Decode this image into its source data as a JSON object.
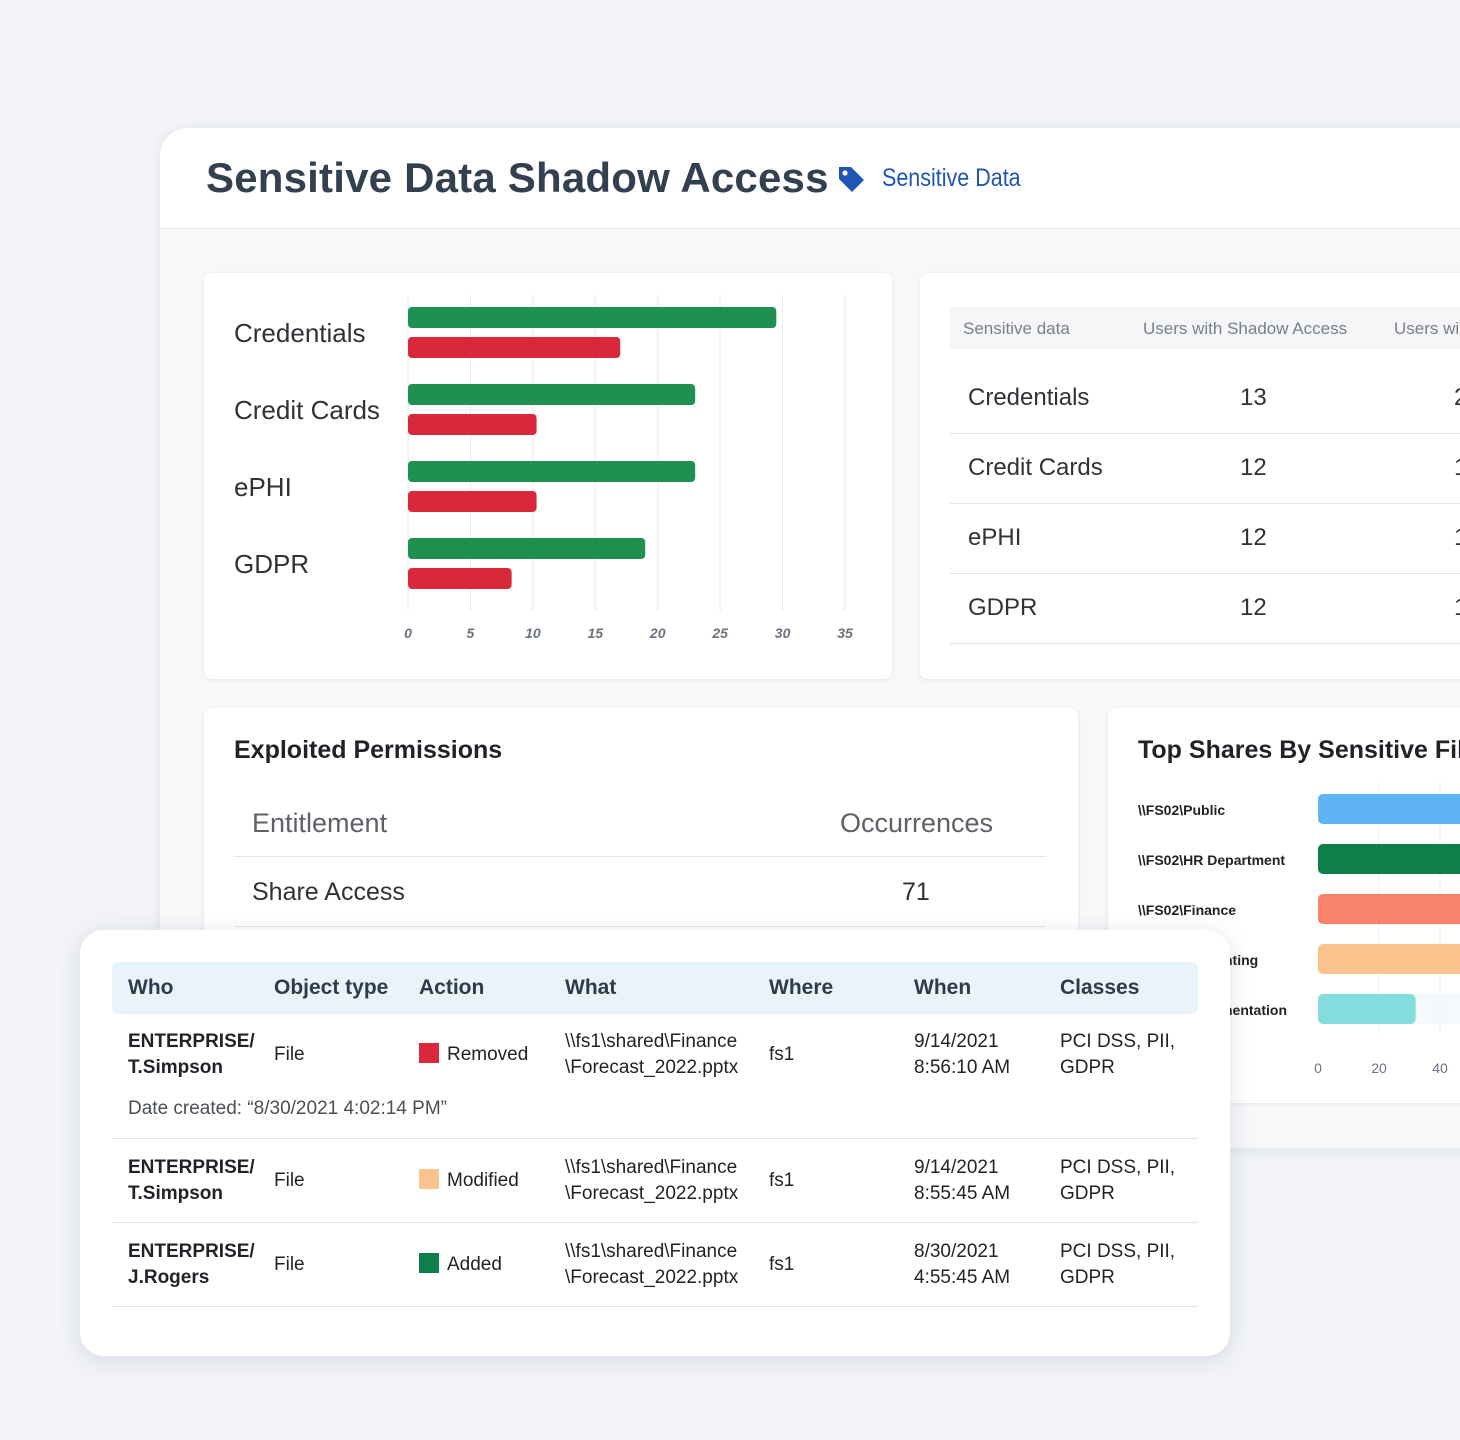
{
  "header": {
    "title": "Sensitive Data Shadow Access",
    "tag_label": "Sensitive Data",
    "tag_color": "#1f56b3"
  },
  "bar_chart": {
    "categories": [
      "Credentials",
      "Credit Cards",
      "ePHI",
      "GDPR"
    ]
  },
  "chart_data": [
    {
      "type": "bar",
      "orientation": "horizontal",
      "categories": [
        "Credentials",
        "Credit Cards",
        "ePHI",
        "GDPR"
      ],
      "series": [
        {
          "color": "#1e9150",
          "values": [
            29.5,
            23,
            23,
            19
          ]
        },
        {
          "color": "#d8283a",
          "values": [
            17,
            10.3,
            10.3,
            8.3
          ]
        }
      ],
      "xlim": [
        0,
        35
      ],
      "xticks": [
        "0",
        "5",
        "10",
        "15",
        "20",
        "25",
        "30",
        "35"
      ],
      "grid": true,
      "title": "",
      "xlabel": "",
      "ylabel": ""
    },
    {
      "type": "bar",
      "orientation": "horizontal",
      "title": "Top Shares By Sensitive Files",
      "categories": [
        "\\\\FS02\\Public",
        "\\\\FS02\\HR Department",
        "\\\\FS02\\Finance",
        "nting",
        "nentation"
      ],
      "visible_labels": [
        "\\\\FS02\\Public",
        "\\\\FS02\\HR Department",
        "\\\\FS02\\Finance",
        "nting",
        "nentation"
      ],
      "xticks": [
        "0",
        "20",
        "40"
      ],
      "values": [
        50,
        50,
        50,
        50,
        32
      ],
      "colors": [
        "#5fb4f6",
        "#0d7f48",
        "#f9826a",
        "#fbc38d",
        "#84dcdc"
      ],
      "grid": true
    }
  ],
  "sensitive_table": {
    "headers": [
      "Sensitive data",
      "Users with Shadow Access",
      "Users wi"
    ],
    "rows": [
      {
        "name": "Credentials",
        "shadow": "13",
        "third": "2"
      },
      {
        "name": "Credit Cards",
        "shadow": "12",
        "third": "1"
      },
      {
        "name": "ePHI",
        "shadow": "12",
        "third": "1"
      },
      {
        "name": "GDPR",
        "shadow": "12",
        "third": "1"
      }
    ]
  },
  "permissions": {
    "title": "Exploited Permissions",
    "col_entitlement": "Entitlement",
    "col_occurrences": "Occurrences",
    "rows": [
      {
        "entitlement": "Share Access",
        "occurrences": "71"
      }
    ]
  },
  "shares": {
    "title": "Top Shares By Sensitive Files",
    "labels": [
      "\\\\FS02\\Public",
      "\\\\FS02\\HR Department",
      "\\\\FS02\\Finance",
      "nting",
      "nentation"
    ],
    "ticks": [
      "0",
      "20",
      "40"
    ]
  },
  "activity": {
    "headers": {
      "who": "Who",
      "object_type": "Object type",
      "action": "Action",
      "what": "What",
      "where": "Where",
      "when": "When",
      "classes": "Classes"
    },
    "rows": [
      {
        "who1": "ENTERPRISE/",
        "who2": "T.Simpson",
        "object_type": "File",
        "action": "Removed",
        "action_color": "#d8283a",
        "what1": "\\\\fs1\\shared\\Finance",
        "what2": "\\Forecast_2022.pptx",
        "where": "fs1",
        "when1": "9/14/2021",
        "when2": "8:56:10 AM",
        "classes1": "PCI DSS, PII,",
        "classes2": "GDPR",
        "note": "Date created: “8/30/2021 4:02:14 PM”"
      },
      {
        "who1": "ENTERPRISE/",
        "who2": "T.Simpson",
        "object_type": "File",
        "action": "Modified",
        "action_color": "#fbc38d",
        "what1": "\\\\fs1\\shared\\Finance",
        "what2": "\\Forecast_2022.pptx",
        "where": "fs1",
        "when1": "9/14/2021",
        "when2": "8:55:45 AM",
        "classes1": "PCI DSS, PII,",
        "classes2": "GDPR"
      },
      {
        "who1": "ENTERPRISE/",
        "who2": "J.Rogers",
        "object_type": "File",
        "action": "Added",
        "action_color": "#0d7f48",
        "what1": "\\\\fs1\\shared\\Finance",
        "what2": "\\Forecast_2022.pptx",
        "where": "fs1",
        "when1": "8/30/2021",
        "when2": "4:55:45 AM",
        "classes1": "PCI DSS, PII,",
        "classes2": "GDPR"
      }
    ]
  }
}
